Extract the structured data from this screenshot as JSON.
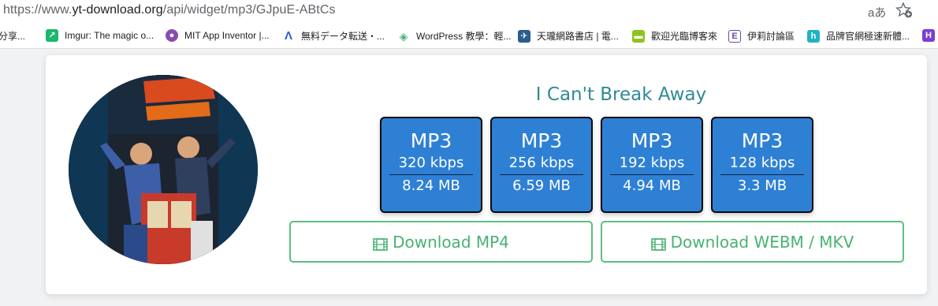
{
  "address_bar": {
    "url_prefix": "https://www.",
    "url_domain": "yt-download.org",
    "url_path": "/api/widget/mp3/GJpuE-ABtCs",
    "read_aloud_glyph": "aあ"
  },
  "bookmarks": [
    {
      "label": "分享...",
      "icon": "share-icon",
      "color": "#6b6b6b"
    },
    {
      "label": "Imgur: The magic o...",
      "icon": "imgur-icon",
      "color": "#1bb76e"
    },
    {
      "label": "MIT App Inventor |...",
      "icon": "app-inventor-icon",
      "color": "#8b4ab2"
    },
    {
      "label": "無料データ転送・...",
      "icon": "transfer-icon",
      "color": "#2d5be3"
    },
    {
      "label": "WordPress 教學：輕...",
      "icon": "wordpress-icon",
      "color": "#4caf7d"
    },
    {
      "label": "天瓏網路書店 | 電...",
      "icon": "bookstore-icon",
      "color": "#2a5d8f"
    },
    {
      "label": "歡迎光臨博客來",
      "icon": "books-icon",
      "color": "#8fc31f"
    },
    {
      "label": "伊莉討論區",
      "icon": "eyny-icon",
      "color": "#6a4c9c"
    },
    {
      "label": "品牌官網極速新體...",
      "icon": "brand-icon",
      "color": "#20b2c4"
    }
  ],
  "song": {
    "title": "I Can't Break Away"
  },
  "formats": [
    {
      "type": "MP3",
      "bitrate": "320 kbps",
      "size": "8.24 MB"
    },
    {
      "type": "MP3",
      "bitrate": "256 kbps",
      "size": "6.59 MB"
    },
    {
      "type": "MP3",
      "bitrate": "192 kbps",
      "size": "4.94 MB"
    },
    {
      "type": "MP3",
      "bitrate": "128 kbps",
      "size": "3.3 MB"
    }
  ],
  "downloads": {
    "mp4_label": "Download MP4",
    "webm_label": "Download WEBM / MKV",
    "icon": "film-icon"
  },
  "colors": {
    "accent_title": "#2f8a93",
    "format_button": "#2e80d5",
    "download_green": "#47b271"
  }
}
